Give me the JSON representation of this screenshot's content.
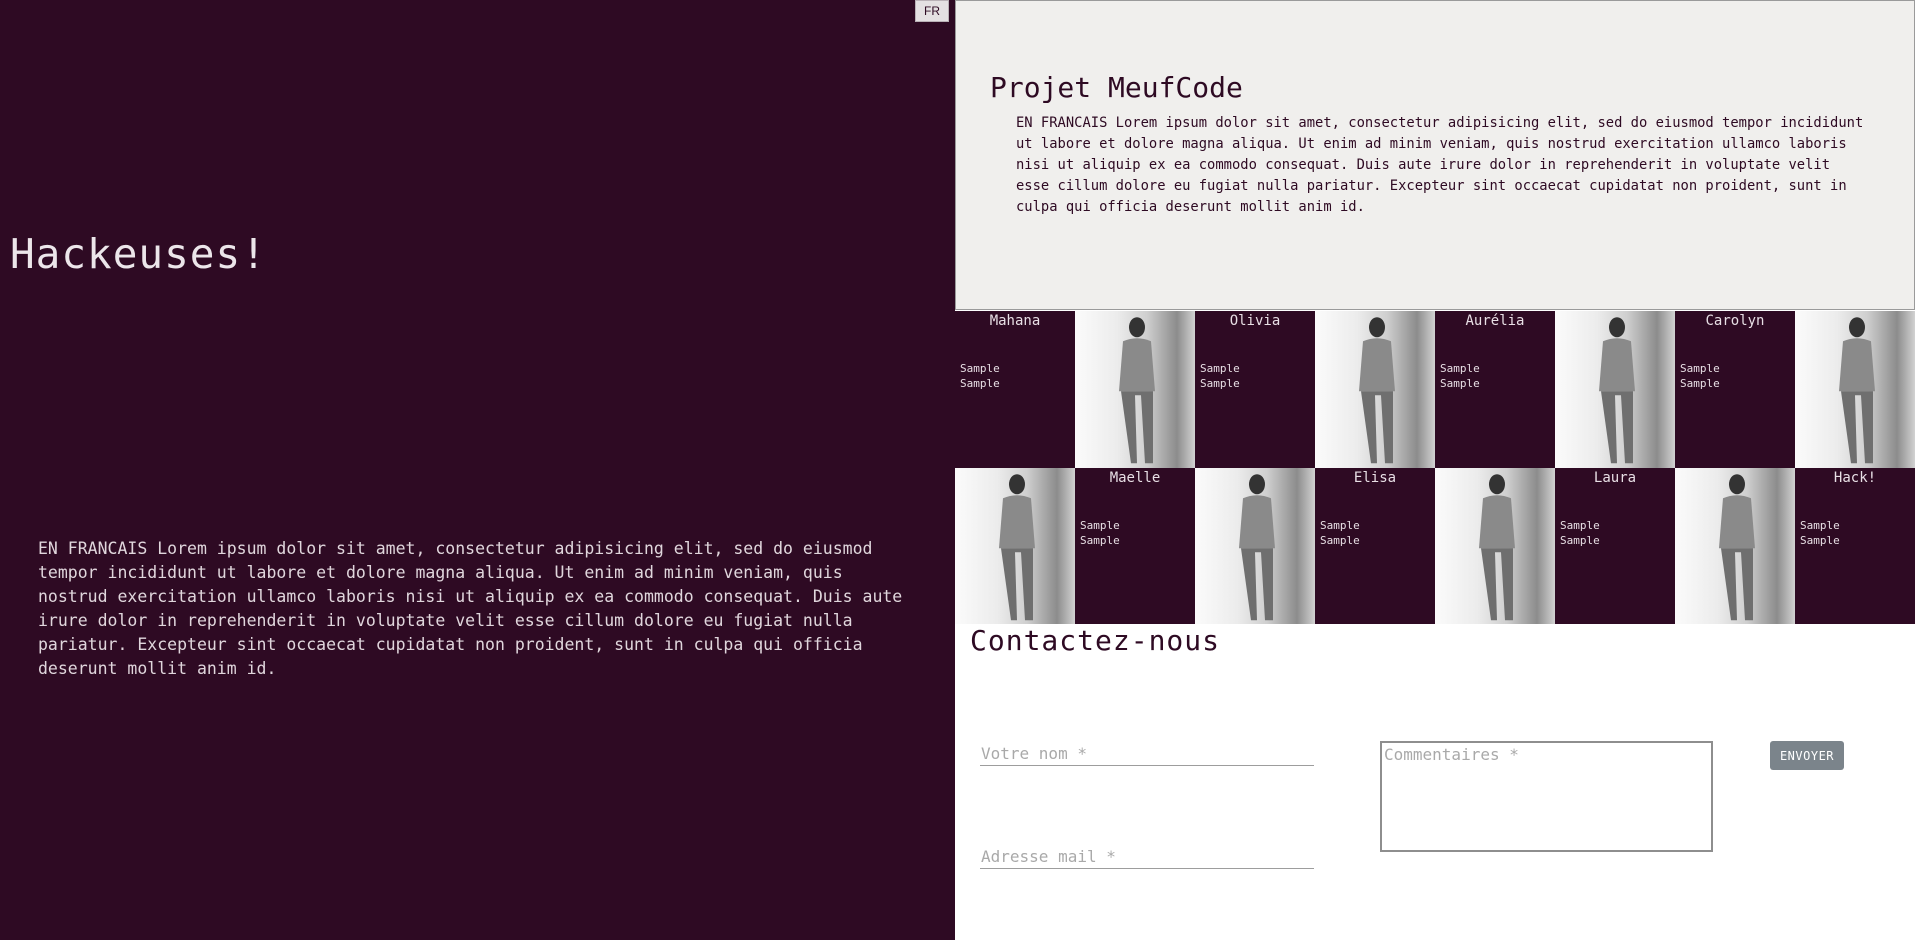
{
  "header": {
    "lang_button": "FR"
  },
  "hero": {
    "title": "Hackeuses!",
    "text": "EN FRANCAIS Lorem ipsum dolor sit amet, consectetur adipisicing elit, sed do eiusmod tempor incididunt ut labore et dolore magna aliqua. Ut enim ad minim veniam, quis nostrud exercitation ullamco laboris nisi ut aliquip ex ea commodo consequat. Duis aute irure dolor in reprehenderit in voluptate velit esse cillum dolore eu fugiat nulla pariatur. Excepteur sint occaecat cupidatat non proident, sunt in culpa qui officia deserunt mollit anim id."
  },
  "project": {
    "title": "Projet MeufCode",
    "text": "EN FRANCAIS Lorem ipsum dolor sit amet, consectetur adipisicing elit, sed do eiusmod tempor incididunt ut labore et dolore magna aliqua. Ut enim ad minim veniam, quis nostrud exercitation ullamco laboris nisi ut aliquip ex ea commodo consequat. Duis aute irure dolor in reprehenderit in voluptate velit esse cillum dolore eu fugiat nulla pariatur. Excepteur sint occaecat cupidatat non proident, sunt in culpa qui officia deserunt mollit anim id."
  },
  "team": {
    "row1": [
      {
        "name": "Mahana",
        "line1": "Sample",
        "line2": "Sample"
      },
      {
        "name": "Olivia",
        "line1": "Sample",
        "line2": "Sample"
      },
      {
        "name": "Aurélia",
        "line1": "Sample",
        "line2": "Sample"
      },
      {
        "name": "Carolyn",
        "line1": "Sample",
        "line2": "Sample"
      }
    ],
    "row2": [
      {
        "name": "Maelle",
        "line1": "Sample",
        "line2": "Sample"
      },
      {
        "name": "Elisa",
        "line1": "Sample",
        "line2": "Sample"
      },
      {
        "name": "Laura",
        "line1": "Sample",
        "line2": "Sample"
      },
      {
        "name": "Hack!",
        "line1": "Sample",
        "line2": "Sample"
      }
    ]
  },
  "contact": {
    "title": "Contactez-nous",
    "name_placeholder": "Votre nom *",
    "email_placeholder": "Adresse mail *",
    "comments_placeholder": "Commentaires *",
    "send_label": "ENVOYER"
  },
  "colors": {
    "primary": "#2e0a23",
    "panel": "#f0efed",
    "button": "#7b848b"
  }
}
